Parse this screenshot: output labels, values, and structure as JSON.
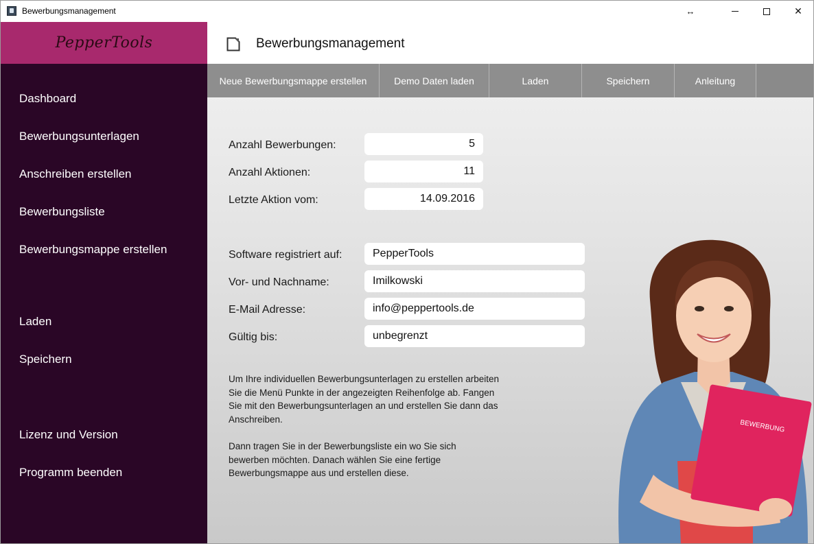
{
  "window": {
    "title": "Bewerbungsmanagement",
    "resize_glyph": "↔",
    "close_glyph": "✕"
  },
  "sidebar": {
    "logo": "PepperTools",
    "items": [
      {
        "label": "Dashboard"
      },
      {
        "label": "Bewerbungsunterlagen"
      },
      {
        "label": "Anschreiben erstellen"
      },
      {
        "label": "Bewerbungsliste"
      },
      {
        "label": "Bewerbungsmappe erstellen"
      },
      {
        "label": "Laden"
      },
      {
        "label": "Speichern"
      },
      {
        "label": "Lizenz und Version"
      },
      {
        "label": "Programm beenden"
      }
    ]
  },
  "header": {
    "title": "Bewerbungsmanagement"
  },
  "toolbar": {
    "buttons": [
      {
        "label": "Neue Bewerbungsmappe erstellen"
      },
      {
        "label": "Demo Daten laden"
      },
      {
        "label": "Laden"
      },
      {
        "label": "Speichern"
      },
      {
        "label": "Anleitung"
      }
    ]
  },
  "stats": {
    "anzahl_bewerbungen_label": "Anzahl Bewerbungen:",
    "anzahl_bewerbungen_value": "5",
    "anzahl_aktionen_label": "Anzahl Aktionen:",
    "anzahl_aktionen_value": "11",
    "letzte_aktion_label": "Letzte Aktion vom:",
    "letzte_aktion_value": "14.09.2016"
  },
  "registration": {
    "registriert_label": "Software registriert auf:",
    "registriert_value": "PepperTools",
    "name_label": "Vor- und Nachname:",
    "name_value": "Imilkowski",
    "email_label": "E-Mail Adresse:",
    "email_value": "info@peppertools.de",
    "gueltig_label": "Gültig bis:",
    "gueltig_value": "unbegrenzt"
  },
  "info": {
    "paragraph1": "Um Ihre individuellen Bewerbungsunterlagen zu erstellen arbeiten Sie die Menü Punkte in der angezeigten Reihenfolge ab. Fangen Sie mit den Bewerbungsunterlagen an und erstellen Sie dann das Anschreiben.",
    "paragraph2": "Dann tragen Sie in der Bewerbungsliste ein wo Sie sich bewerben möchten. Danach wählen Sie eine fertige Bewerbungsmappe aus und erstellen diese."
  },
  "photo": {
    "folder_label": "BEWERBUNG"
  },
  "colors": {
    "sidebar_bg": "#2a0626",
    "logo_bg": "#a8296d",
    "toolbar_bg": "#8e8e8e",
    "folder": "#e0245e"
  }
}
